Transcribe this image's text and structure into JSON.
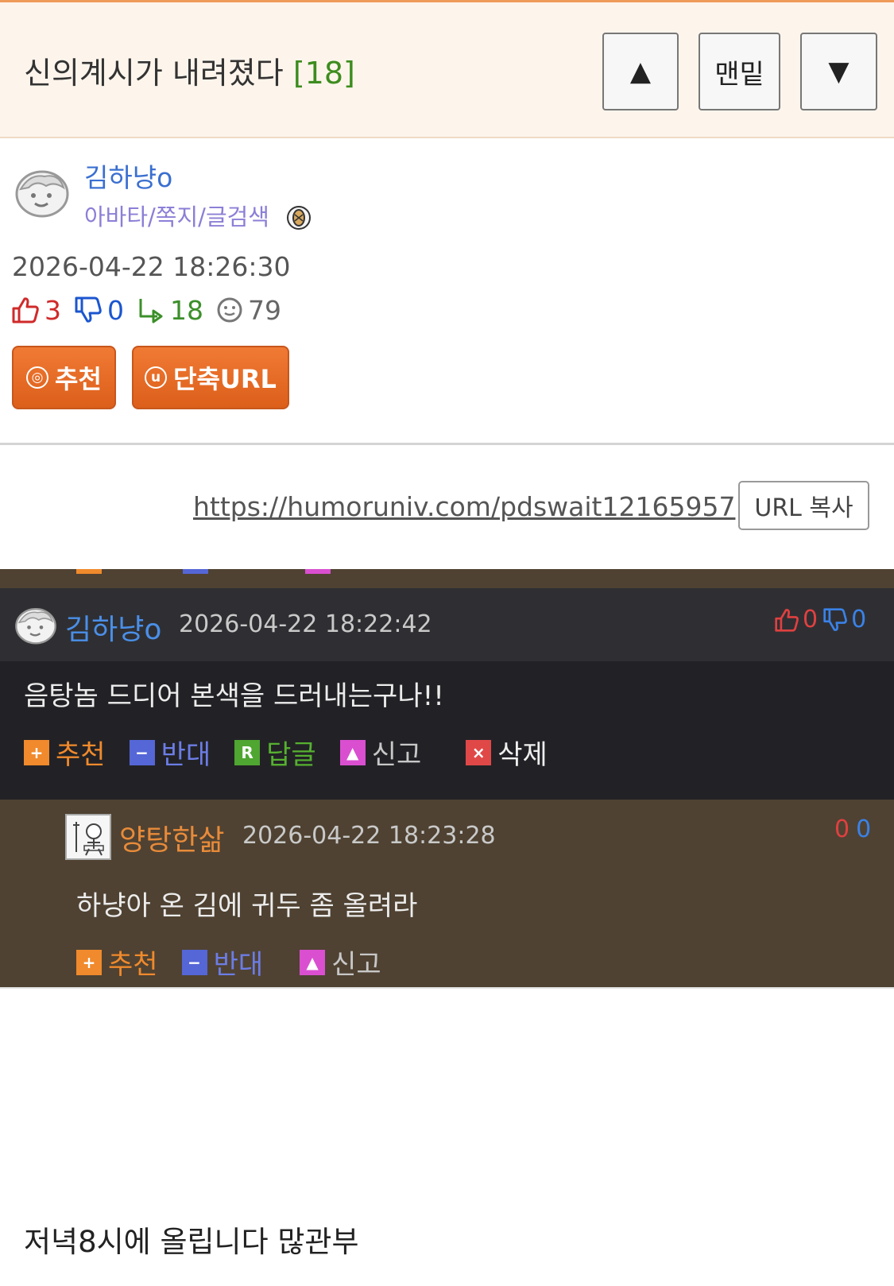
{
  "header": {
    "title": "신의계시가 내려졌다",
    "count": "[18]",
    "nav_up": "▲",
    "nav_bottom": "맨밑",
    "nav_down": "▼"
  },
  "author": {
    "avatar_icon": "smiling-face-avatar-icon",
    "name": "김하냥o",
    "links": "아바타/쪽지/글검색",
    "badge_icon": "peanut-badge-icon"
  },
  "post": {
    "date": "2026-04-22 18:26:30",
    "up_count": "3",
    "down_count": "0",
    "reply_count": "18",
    "view_count": "79",
    "recommend_label": "추천",
    "recommend_icon_char": "◎",
    "shorturl_label": "단축URL",
    "shorturl_icon_char": "u",
    "url": "https://humoruniv.com/pdswait12165957",
    "copy_label": "URL 복사",
    "body": "저녁8시에 올립니다 많관부"
  },
  "comments": [
    {
      "author": "김하냥o",
      "date": "2026-04-22 18:22:42",
      "up": "0",
      "down": "0",
      "text": "음탕놈 드디어 본색을 드러내는구나!!",
      "actions": {
        "recommend": "추천",
        "oppose": "반대",
        "reply": "답글",
        "report": "신고",
        "delete": "삭제"
      }
    },
    {
      "author": "양탕한삶",
      "date": "2026-04-22 18:23:28",
      "up": "0",
      "down": "0",
      "text": "하냥아 온 김에 귀두 좀 올려라",
      "actions": {
        "recommend": "추천",
        "oppose": "반대",
        "report": "신고"
      }
    }
  ],
  "colors": {
    "header_bg": "#fdf5ec",
    "accent_orange": "#e86a22",
    "author_blue": "#3a6fd0",
    "count_green": "#3d8c1e",
    "comment_bg_dark": "#222226",
    "comment_bg_brown": "#4f4232"
  }
}
